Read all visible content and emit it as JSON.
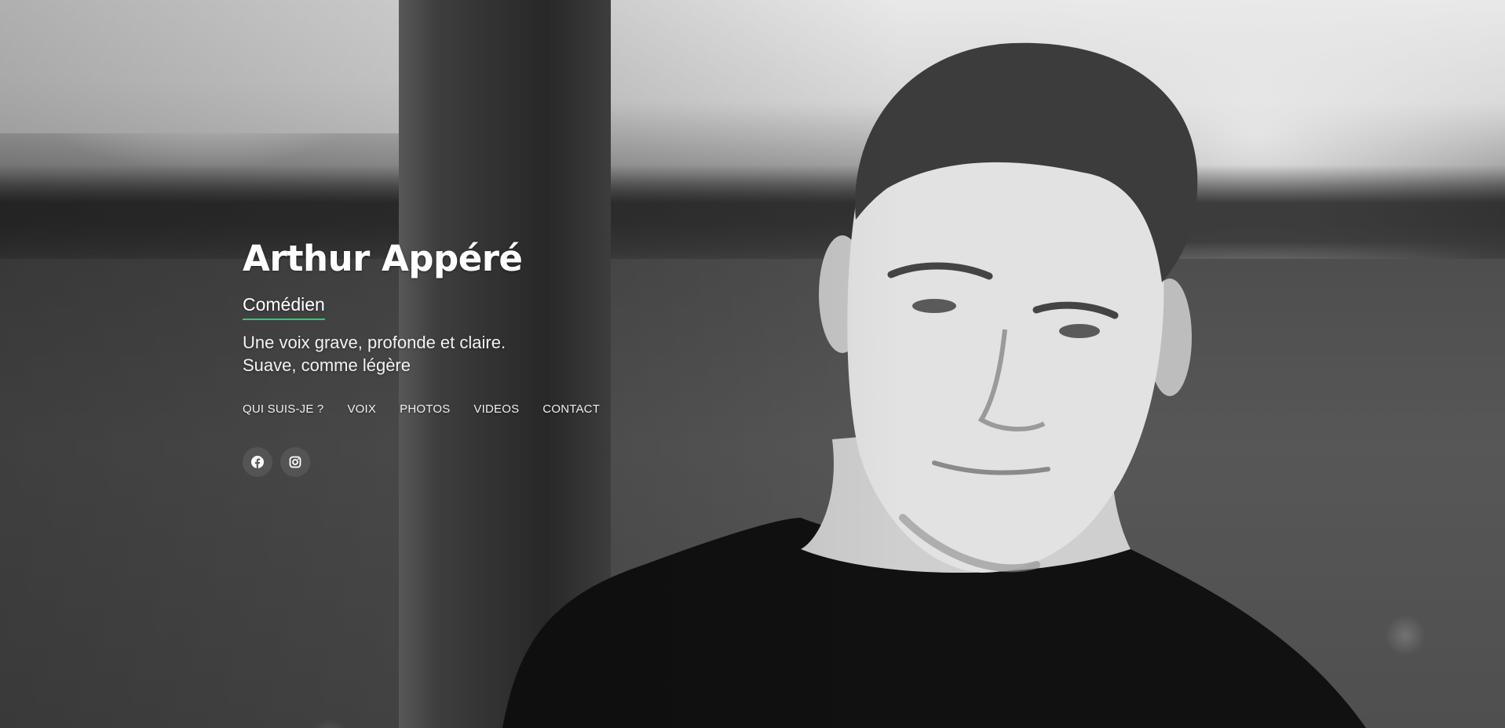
{
  "hero": {
    "name": "Arthur Appéré",
    "role": "Comédien",
    "tagline_line1": "Une voix grave, profonde et claire.",
    "tagline_line2": "Suave, comme légère"
  },
  "nav": {
    "items": [
      {
        "label": "QUI SUIS-JE ?"
      },
      {
        "label": "VOIX"
      },
      {
        "label": "PHOTOS"
      },
      {
        "label": "VIDEOS"
      },
      {
        "label": "CONTACT"
      }
    ]
  },
  "socials": {
    "items": [
      {
        "icon": "facebook-icon"
      },
      {
        "icon": "instagram-icon"
      }
    ]
  },
  "colors": {
    "accent": "#2ecc71",
    "text": "#ffffff"
  }
}
